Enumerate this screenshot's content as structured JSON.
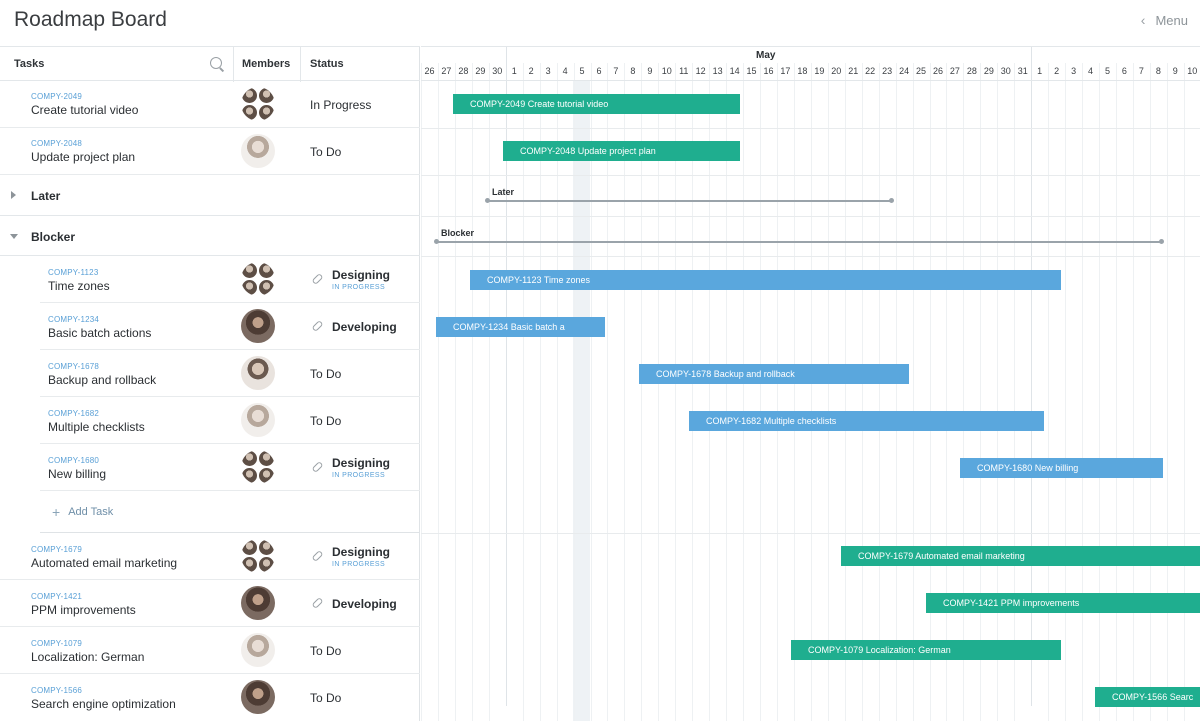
{
  "app": {
    "title": "Roadmap Board",
    "menu_label": "Menu"
  },
  "columns": {
    "tasks": "Tasks",
    "members": "Members",
    "status": "Status"
  },
  "timeline": {
    "month": "May",
    "days": [
      "26",
      "27",
      "28",
      "29",
      "30",
      "1",
      "2",
      "3",
      "4",
      "5",
      "6",
      "7",
      "8",
      "9",
      "10",
      "11",
      "12",
      "13",
      "14",
      "15",
      "16",
      "17",
      "18",
      "19",
      "20",
      "21",
      "22",
      "23",
      "24",
      "25",
      "26",
      "27",
      "28",
      "29",
      "30",
      "31",
      "1",
      "2",
      "3",
      "4",
      "5",
      "6",
      "7",
      "8",
      "9",
      "10"
    ]
  },
  "tasks": [
    {
      "id": "COMPY-2049",
      "name": "Create tutorial video",
      "status": "In Progress",
      "bar_label": "COMPY-2049  Create tutorial video"
    },
    {
      "id": "COMPY-2048",
      "name": "Update project plan",
      "status": "To Do",
      "bar_label": "COMPY-2048  Update project plan"
    }
  ],
  "groups": {
    "later": {
      "name": "Later"
    },
    "blocker": {
      "name": "Blocker"
    }
  },
  "blocker_tasks": [
    {
      "id": "COMPY-1123",
      "name": "Time zones",
      "status": "Designing",
      "sub": "IN PROGRESS",
      "bar_label": "COMPY-1123  Time zones"
    },
    {
      "id": "COMPY-1234",
      "name": "Basic batch actions",
      "status": "Developing",
      "sub": "",
      "bar_label": "COMPY-1234  Basic batch a"
    },
    {
      "id": "COMPY-1678",
      "name": "Backup and rollback",
      "status": "To Do",
      "sub": "",
      "bar_label": "COMPY-1678  Backup and rollback"
    },
    {
      "id": "COMPY-1682",
      "name": "Multiple checklists",
      "status": "To Do",
      "sub": "",
      "bar_label": "COMPY-1682  Multiple checklists"
    },
    {
      "id": "COMPY-1680",
      "name": "New billing",
      "status": "Designing",
      "sub": "IN PROGRESS",
      "bar_label": "COMPY-1680  New billing"
    }
  ],
  "add_task_label": "Add Task",
  "more_tasks": [
    {
      "id": "COMPY-1679",
      "name": "Automated email marketing",
      "status": "Designing",
      "sub": "IN PROGRESS",
      "bar_label": "COMPY-1679  Automated email marketing"
    },
    {
      "id": "COMPY-1421",
      "name": "PPM improvements",
      "status": "Developing",
      "sub": "",
      "bar_label": "COMPY-1421  PPM improvements"
    },
    {
      "id": "COMPY-1079",
      "name": "Localization: German",
      "status": "To Do",
      "sub": "",
      "bar_label": "COMPY-1079  Localization: German"
    },
    {
      "id": "COMPY-1566",
      "name": "Search engine optimization",
      "status": "To Do",
      "sub": "",
      "bar_label": "COMPY-1566  Searc"
    }
  ],
  "colors": {
    "green_bar": "#1fae8f",
    "blue_bar": "#5aa7dd",
    "id_text": "#5aa0d6"
  }
}
